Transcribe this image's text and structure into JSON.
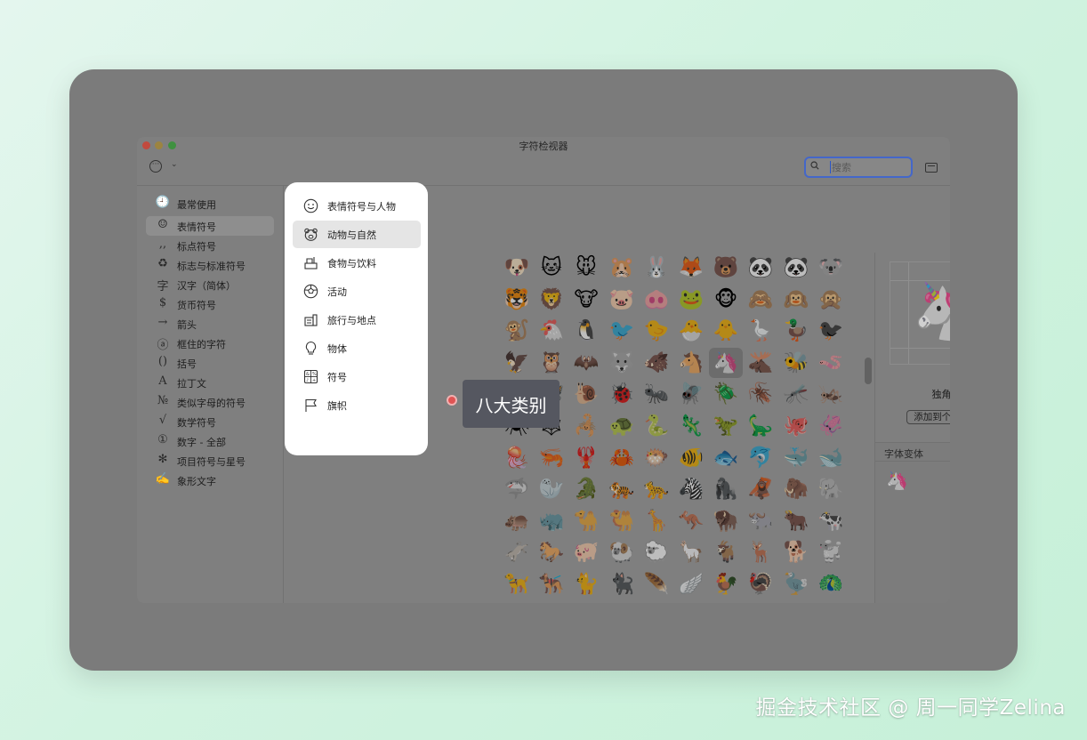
{
  "window": {
    "title": "字符检视器"
  },
  "toolbar": {
    "search_placeholder": "搜索"
  },
  "sidebar": {
    "items": [
      {
        "icon": "🕘",
        "label": "最常使用"
      },
      {
        "icon": "☺",
        "label": "表情符号"
      },
      {
        "icon": ",,",
        "label": "标点符号"
      },
      {
        "icon": "♻",
        "label": "标志与标准符号"
      },
      {
        "icon": "字",
        "label": "汉字（简体）"
      },
      {
        "icon": "$",
        "label": "货币符号"
      },
      {
        "icon": "→",
        "label": "箭头"
      },
      {
        "icon": "ⓐ",
        "label": "框住的字符"
      },
      {
        "icon": "()",
        "label": "括号"
      },
      {
        "icon": "A",
        "label": "拉丁文"
      },
      {
        "icon": "№",
        "label": "类似字母的符号"
      },
      {
        "icon": "√",
        "label": "数学符号"
      },
      {
        "icon": "①",
        "label": "数字 - 全部"
      },
      {
        "icon": "✻",
        "label": "项目符号与星号"
      },
      {
        "icon": "✍",
        "label": "象形文字"
      }
    ]
  },
  "popover": {
    "items": [
      {
        "icon": "smiley-icon",
        "label": "表情符号与人物"
      },
      {
        "icon": "bear-icon",
        "label": "动物与自然"
      },
      {
        "icon": "food-icon",
        "label": "食物与饮料"
      },
      {
        "icon": "ball-icon",
        "label": "活动"
      },
      {
        "icon": "building-icon",
        "label": "旅行与地点"
      },
      {
        "icon": "bulb-icon",
        "label": "物体"
      },
      {
        "icon": "symbols-icon",
        "label": "符号"
      },
      {
        "icon": "flag-icon",
        "label": "旗帜"
      }
    ]
  },
  "emoji_grid": [
    [
      "🐶",
      "🐱",
      "🐭",
      "🐹",
      "🐰",
      "🦊",
      "🐻",
      "🐼",
      "🐼",
      "🐨"
    ],
    [
      "🐯",
      "🦁",
      "🐮",
      "🐷",
      "🐽",
      "🐸",
      "🐵",
      "🙈",
      "🙉",
      "🙊"
    ],
    [
      "🐒",
      "🐔",
      "🐧",
      "🐦",
      "🐤",
      "🐣",
      "🐥",
      "🪿",
      "🦆",
      "🐦‍⬛"
    ],
    [
      "🦅",
      "🦉",
      "🦇",
      "🐺",
      "🐗",
      "🐴",
      "🦄",
      "🫎",
      "🐝",
      "🪱"
    ],
    [
      "🐛",
      "🦋",
      "🐌",
      "🐞",
      "🐜",
      "🪰",
      "🪲",
      "🪳",
      "🦟",
      "🦗"
    ],
    [
      "🕷",
      "🕸",
      "🦂",
      "🐢",
      "🐍",
      "🦎",
      "🦖",
      "🦕",
      "🐙",
      "🦑"
    ],
    [
      "🪼",
      "🦐",
      "🦞",
      "🦀",
      "🐡",
      "🐠",
      "🐟",
      "🐬",
      "🐳",
      "🐋"
    ],
    [
      "🦈",
      "🦭",
      "🐊",
      "🐅",
      "🐆",
      "🦓",
      "🦍",
      "🦧",
      "🦣",
      "🐘"
    ],
    [
      "🦛",
      "🦏",
      "🐪",
      "🐫",
      "🦒",
      "🦘",
      "🦬",
      "🐃",
      "🐂",
      "🐄"
    ],
    [
      "🫏",
      "🐎",
      "🐖",
      "🐏",
      "🐑",
      "🦙",
      "🐐",
      "🦌",
      "🐕",
      "🐩"
    ],
    [
      "🦮",
      "🐕‍🦺",
      "🐈",
      "🐈‍⬛",
      "🪶",
      "🪽",
      "🐓",
      "🦃",
      "🦤",
      "🦚"
    ],
    [
      "🦜",
      "🦢",
      "🦩",
      "🕊",
      "🐇",
      "🦝",
      "🦨",
      "🦡",
      "🦫",
      "🦦"
    ],
    [
      "🦥",
      "🐁",
      "🐀",
      "🐿",
      "🦔",
      "🐾",
      "🐉",
      "🐲",
      "🐦‍🔥",
      "🌵"
    ]
  ],
  "selected": {
    "emoji": "🦄",
    "name": "独角兽",
    "fav_label": "添加到个人收藏",
    "variants_header": "字体变体",
    "variants": [
      "🦄"
    ]
  },
  "annotation": {
    "tooltip": "八大类别"
  },
  "watermark": "掘金技术社区 @ 周一同学Zelina",
  "colors": {
    "background": "#d2f3e1",
    "overlay": "#7b7b7b",
    "popover": "#ffffff",
    "search_focus": "#4467c9",
    "tooltip": "#555760"
  }
}
